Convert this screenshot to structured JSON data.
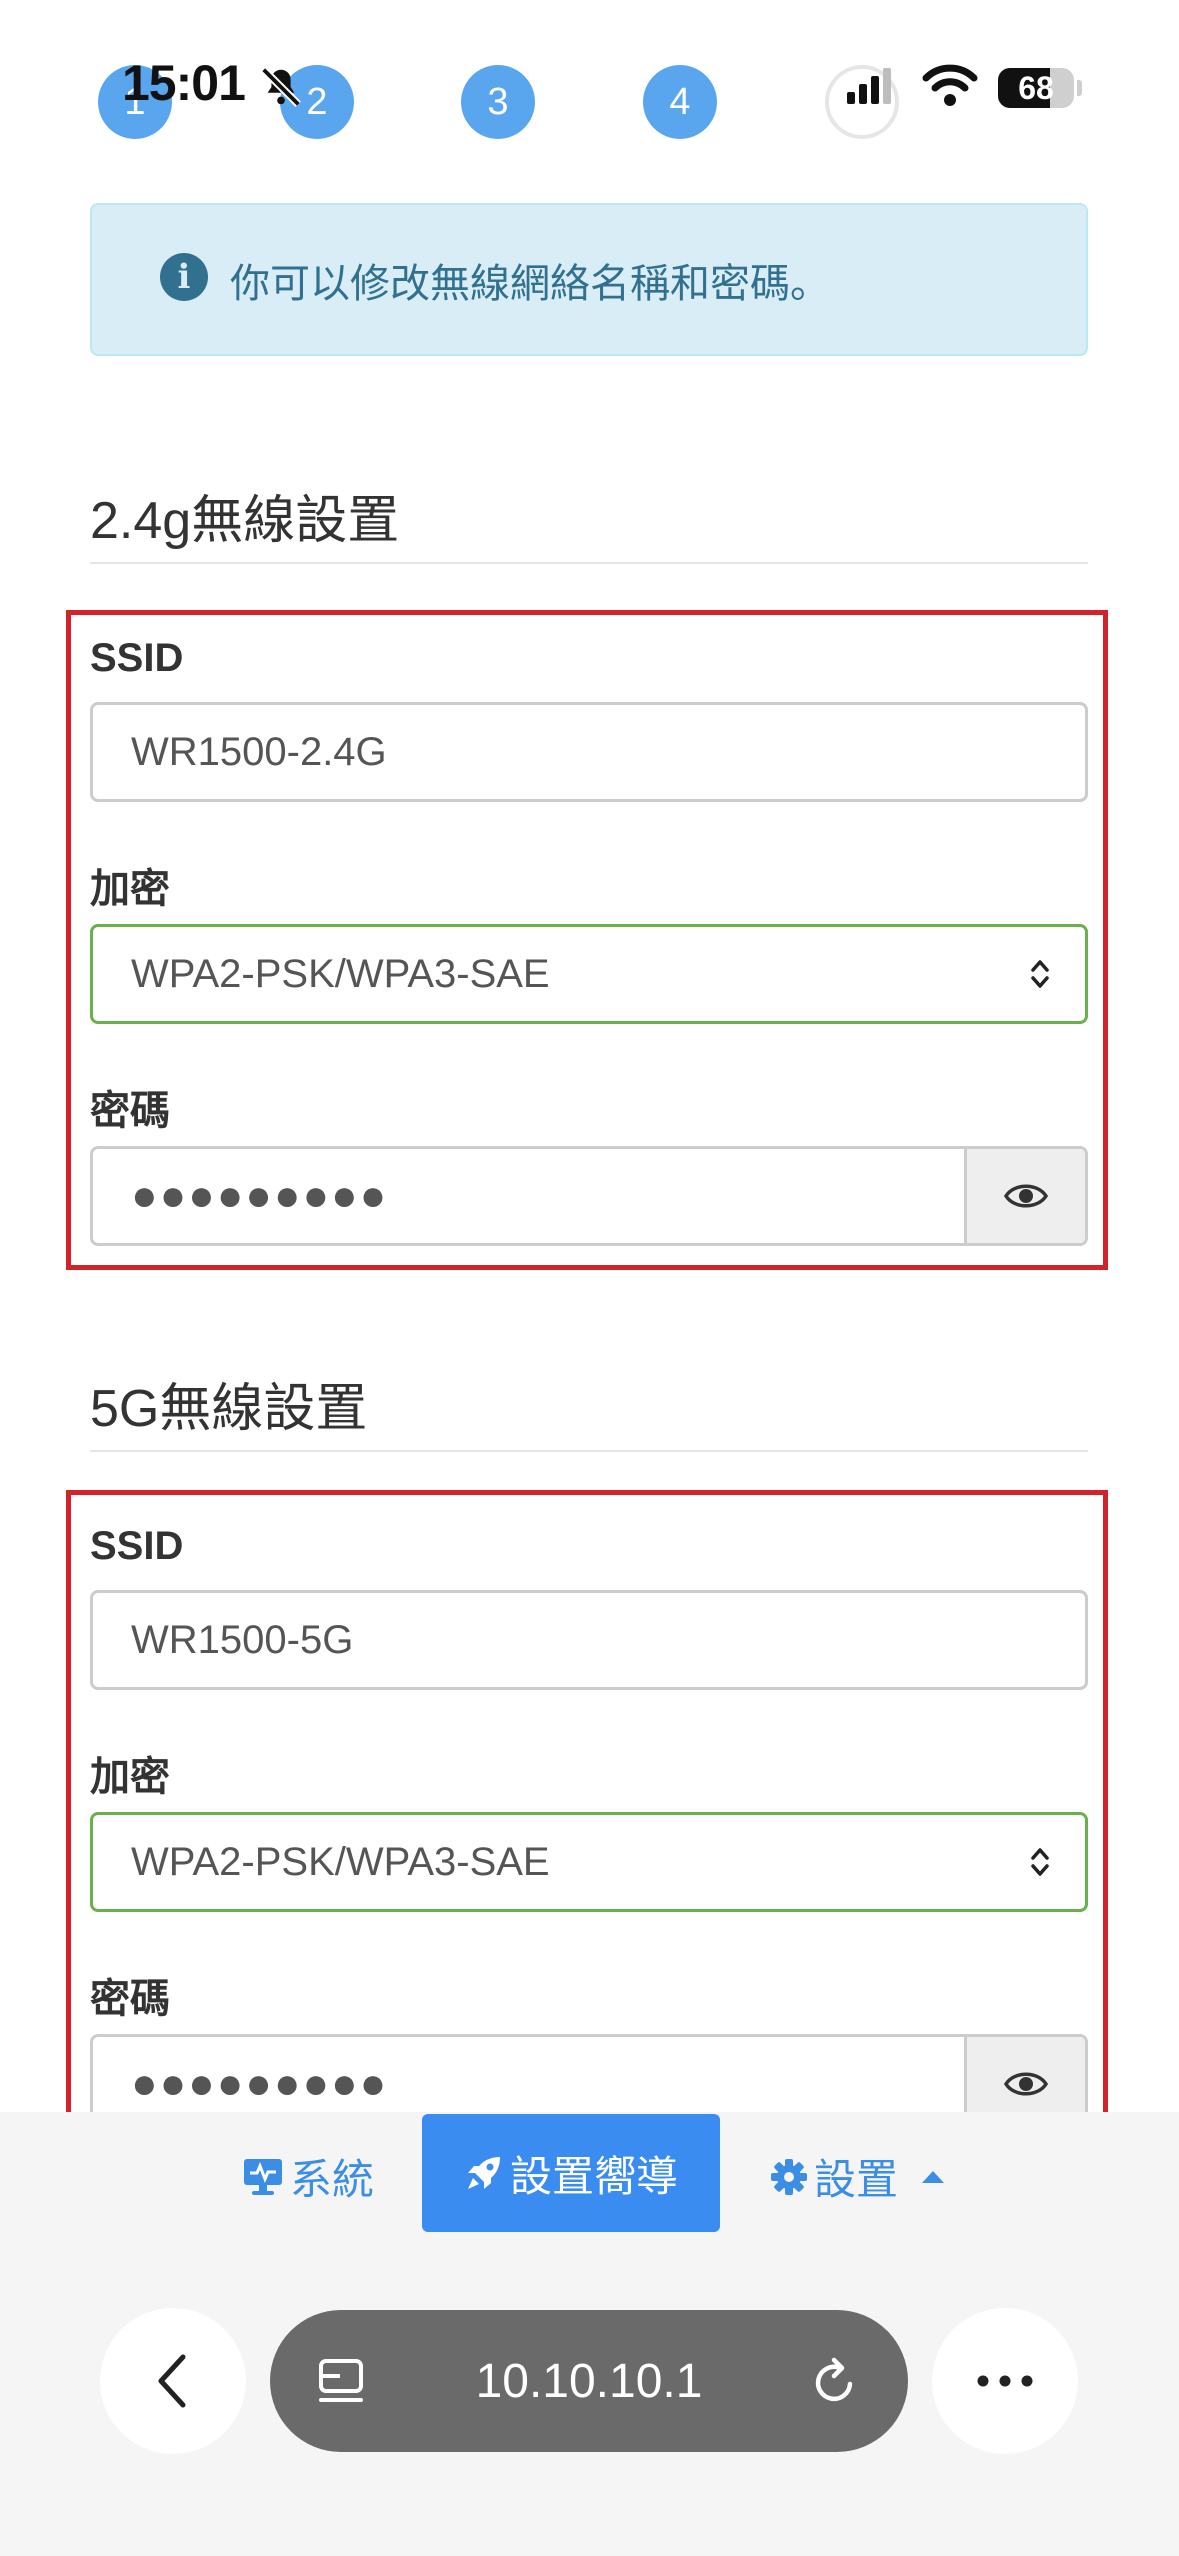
{
  "status_bar": {
    "time": "15:01",
    "battery": "68"
  },
  "steps": [
    "1",
    "2",
    "3",
    "4"
  ],
  "alert": {
    "text": "你可以修改無線網絡名稱和密碼。"
  },
  "section_24g": {
    "title": "2.4g無線設置",
    "ssid_label": "SSID",
    "ssid_value": "WR1500-2.4G",
    "encryption_label": "加密",
    "encryption_value": "WPA2-PSK/WPA3-SAE",
    "password_label": "密碼",
    "password_masked": "●●●●●●●●●"
  },
  "section_5g": {
    "title": "5G無線設置",
    "ssid_label": "SSID",
    "ssid_value": "WR1500-5G",
    "encryption_label": "加密",
    "encryption_value": "WPA2-PSK/WPA3-SAE",
    "password_label": "密碼",
    "password_masked": "●●●●●●●●●"
  },
  "bottom_nav": {
    "system": "系統",
    "wizard": "設置嚮導",
    "settings": "設置"
  },
  "browser": {
    "url": "10.10.10.1"
  },
  "colors": {
    "accent": "#3b8cf0",
    "highlight_border": "#d0232a",
    "select_border": "#6ab04c",
    "alert_bg": "#d9edf7",
    "alert_text": "#31708f"
  }
}
